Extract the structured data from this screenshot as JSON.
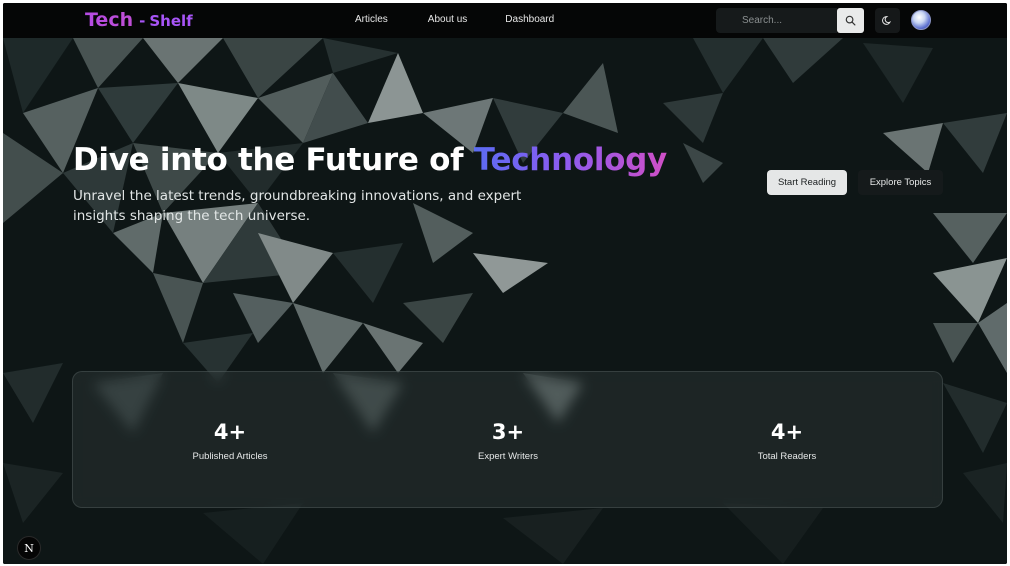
{
  "nav": {
    "logo_main": "Tech",
    "logo_sep": "-",
    "logo_sub": "Shelf",
    "links": [
      "Articles",
      "About us",
      "Dashboard"
    ],
    "search_placeholder": "Search...",
    "icons": {
      "search": "search-icon",
      "theme": "moon-icon",
      "avatar": "avatar"
    }
  },
  "hero": {
    "title_prefix": "Dive into the Future of ",
    "title_accent": "Technology",
    "subtitle": "Unravel the latest trends, groundbreaking innovations, and expert insights shaping the tech universe.",
    "primary_button": "Start Reading",
    "secondary_button": "Explore Topics"
  },
  "stats": [
    {
      "value": "4+",
      "label": "Published Articles"
    },
    {
      "value": "3+",
      "label": "Expert Writers"
    },
    {
      "value": "4+",
      "label": "Total Readers"
    }
  ],
  "badge": {
    "label": "N"
  },
  "colors": {
    "accent_purple": "#a855f7",
    "title_gradient_start": "#5b6cf2",
    "title_gradient_end": "#d04fc6",
    "background": "#0d1414"
  }
}
